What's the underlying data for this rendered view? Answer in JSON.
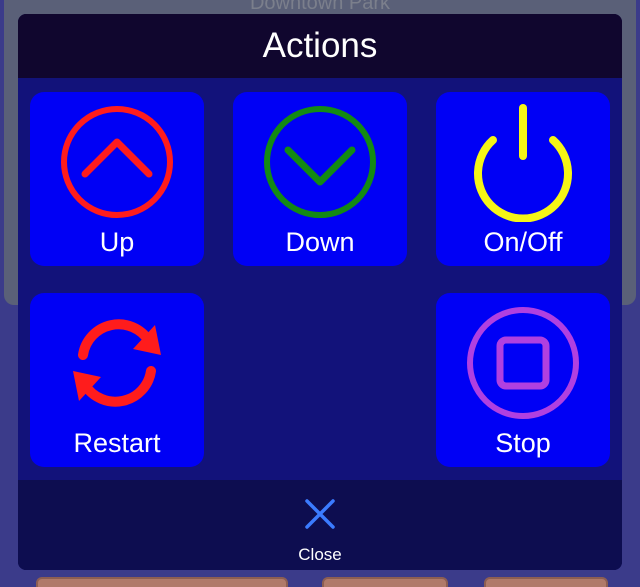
{
  "background": {
    "map_title": "Downtown Park"
  },
  "modal": {
    "title": "Actions",
    "actions": [
      {
        "label": "Up",
        "icon": "chevron-up-circle-icon",
        "color": "#ff1c1c"
      },
      {
        "label": "Down",
        "icon": "chevron-down-circle-icon",
        "color": "#138a13"
      },
      {
        "label": "On/Off",
        "icon": "power-icon",
        "color": "#f5f516"
      },
      {
        "label": "Restart",
        "icon": "refresh-icon",
        "color": "#ff1c1c"
      },
      {
        "label": "Stop",
        "icon": "stop-icon",
        "color": "#b040e0"
      }
    ],
    "close_label": "Close",
    "close_icon": "close-icon",
    "accent": "#3b7bff"
  }
}
